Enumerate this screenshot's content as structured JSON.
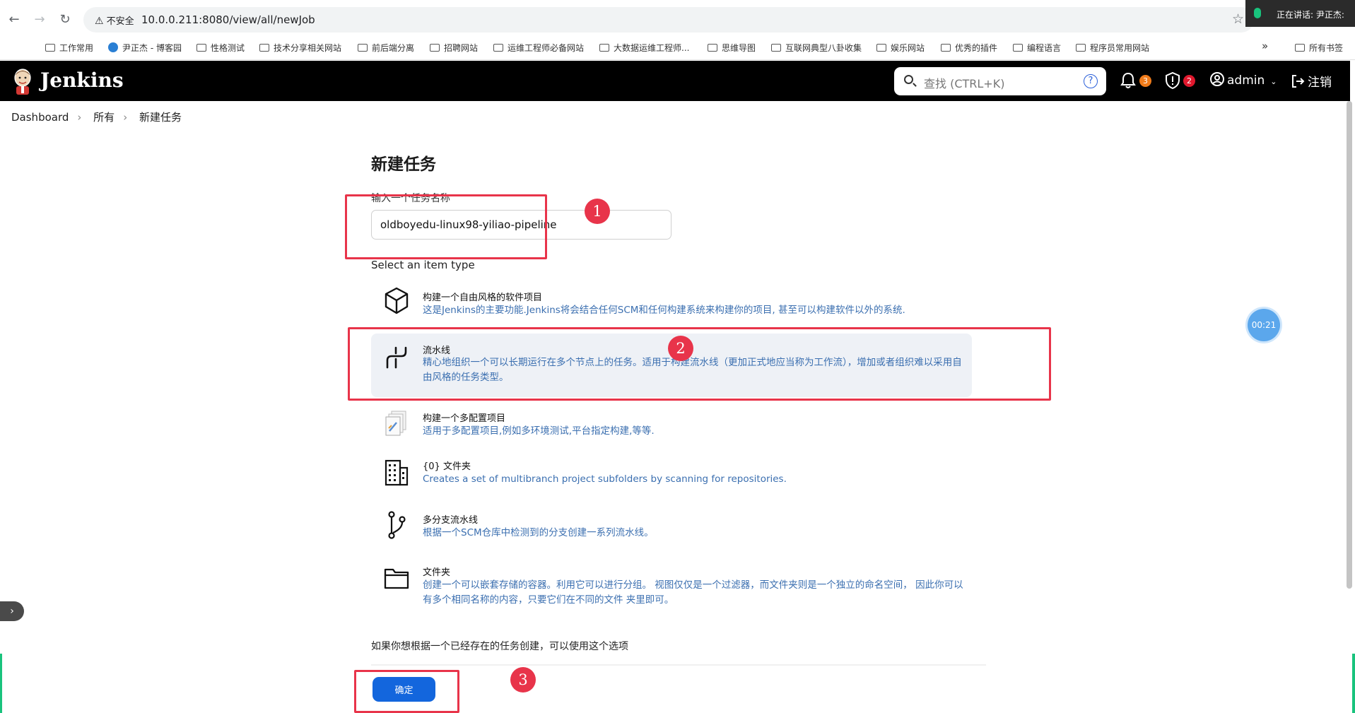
{
  "browser": {
    "security_label": "不安全",
    "url": "10.0.0.211:8080/view/all/newJob",
    "speaking_label": "正在讲话:  尹正杰:"
  },
  "bookmarks": [
    {
      "label": "工作常用",
      "icon": "folder-icon"
    },
    {
      "label": "尹正杰 - 博客园",
      "icon": "site-icon"
    },
    {
      "label": "性格测试",
      "icon": "folder-icon"
    },
    {
      "label": "技术分享相关网站",
      "icon": "folder-icon"
    },
    {
      "label": "前后端分离",
      "icon": "folder-icon"
    },
    {
      "label": "招聘网站",
      "icon": "folder-icon"
    },
    {
      "label": "运维工程师必备网站",
      "icon": "folder-icon"
    },
    {
      "label": "大数据运维工程师...",
      "icon": "folder-icon"
    },
    {
      "label": "思维导图",
      "icon": "folder-icon"
    },
    {
      "label": "互联网典型八卦收集",
      "icon": "folder-icon"
    },
    {
      "label": "娱乐网站",
      "icon": "folder-icon"
    },
    {
      "label": "优秀的插件",
      "icon": "folder-icon"
    },
    {
      "label": "编程语言",
      "icon": "folder-icon"
    },
    {
      "label": "程序员常用网站",
      "icon": "folder-icon"
    }
  ],
  "bookmarks_more": "»",
  "bookmarks_all": "所有书签",
  "header": {
    "title": "Jenkins",
    "search_placeholder": "查找 (CTRL+K)",
    "help": "?",
    "notifications_count": "3",
    "security_count": "2",
    "user": "admin",
    "logout": "注销"
  },
  "breadcrumb": [
    "Dashboard",
    "所有",
    "新建任务"
  ],
  "page": {
    "title": "新建任务",
    "name_label": "输入一个任务名称",
    "name_value": "oldboyedu-linux98-yiliao-pipeline",
    "type_label": "Select an item type",
    "copy_label": "如果你想根据一个已经存在的任务创建，可以使用这个选项",
    "ok_label": "确定"
  },
  "item_types": [
    {
      "title": "构建一个自由风格的软件项目",
      "desc": "这是Jenkins的主要功能.Jenkins将会结合任何SCM和任何构建系统来构建你的项目, 甚至可以构建软件以外的系统.",
      "icon": "cube-icon",
      "selected": false
    },
    {
      "title": "流水线",
      "desc": "精心地组织一个可以长期运行在多个节点上的任务。适用于构建流水线（更加正式地应当称为工作流），增加或者组织难以采用自由风格的任务类型。",
      "icon": "pipeline-icon",
      "selected": true
    },
    {
      "title": "构建一个多配置项目",
      "desc": "适用于多配置项目,例如多环境测试,平台指定构建,等等.",
      "icon": "multi-config-icon",
      "selected": false
    },
    {
      "title": "{0} 文件夹",
      "desc": "Creates a set of multibranch project subfolders by scanning for repositories.",
      "icon": "organization-icon",
      "selected": false
    },
    {
      "title": "多分支流水线",
      "desc": "根据一个SCM仓库中检测到的分支创建一系列流水线。",
      "icon": "branch-icon",
      "selected": false
    },
    {
      "title": "文件夹",
      "desc": "创建一个可以嵌套存储的容器。利用它可以进行分组。 视图仅仅是一个过滤器，而文件夹则是一个独立的命名空间， 因此你可以有多个相同名称的内容，只要它们在不同的文件 夹里即可。",
      "icon": "folder-icon",
      "selected": false
    }
  ],
  "annotations": [
    "1",
    "2",
    "3"
  ],
  "timer": "00:21",
  "colors": {
    "accent": "#1366dd",
    "annotation": "#e8344a",
    "header": "#000000",
    "link_desc": "#3b6fb0"
  }
}
